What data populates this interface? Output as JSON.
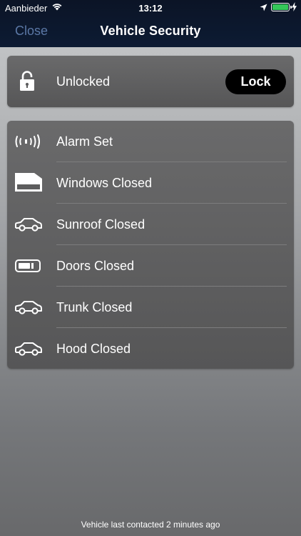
{
  "status_bar": {
    "carrier": "Aanbieder",
    "time": "13:12",
    "icons": [
      "wifi-icon",
      "location-arrow-icon",
      "battery-icon",
      "charging-bolt-icon"
    ],
    "battery_color": "#34c759"
  },
  "nav": {
    "close_label": "Close",
    "title": "Vehicle Security",
    "close_color": "#5b78a6"
  },
  "lock_card": {
    "icon": "unlocked-padlock-icon",
    "status_label": "Unlocked",
    "lock_button_label": "Lock"
  },
  "status_items": [
    {
      "icon": "alarm-icon",
      "label": "Alarm Set"
    },
    {
      "icon": "windows-icon",
      "label": "Windows Closed"
    },
    {
      "icon": "car-icon",
      "label": "Sunroof Closed"
    },
    {
      "icon": "door-icon",
      "label": "Doors Closed"
    },
    {
      "icon": "car-icon",
      "label": "Trunk Closed"
    },
    {
      "icon": "car-icon",
      "label": "Hood Closed"
    }
  ],
  "footer": {
    "last_contacted": "Vehicle last contacted 2 minutes ago"
  }
}
